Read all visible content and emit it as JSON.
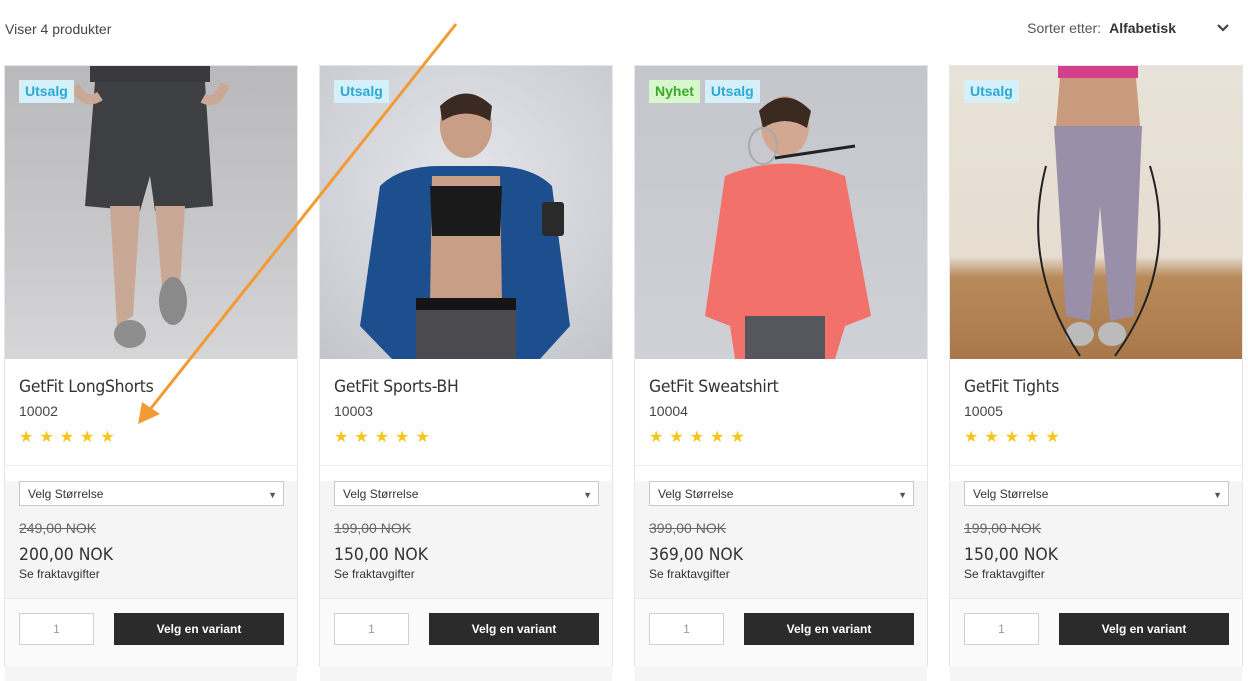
{
  "toolbar": {
    "count_text": "Viser 4 produkter",
    "sort_label": "Sorter etter:",
    "sort_value": "Alfabetisk"
  },
  "products": [
    {
      "badges": [
        "Utsalg"
      ],
      "name": "GetFit LongShorts",
      "sku": "10002",
      "rating": 5,
      "select_label": "Velg Størrelse",
      "old_price": "249,00 NOK",
      "price": "200,00 NOK",
      "shipping": "Se fraktavgifter",
      "qty": "1",
      "button": "Velg en variant"
    },
    {
      "badges": [
        "Utsalg"
      ],
      "name": "GetFit Sports-BH",
      "sku": "10003",
      "rating": 5,
      "select_label": "Velg Størrelse",
      "old_price": "199,00 NOK",
      "price": "150,00 NOK",
      "shipping": "Se fraktavgifter",
      "qty": "1",
      "button": "Velg en variant"
    },
    {
      "badges": [
        "Nyhet",
        "Utsalg"
      ],
      "name": "GetFit Sweatshirt",
      "sku": "10004",
      "rating": 5,
      "select_label": "Velg Størrelse",
      "old_price": "399,00 NOK",
      "price": "369,00 NOK",
      "shipping": "Se fraktavgifter",
      "qty": "1",
      "button": "Velg en variant"
    },
    {
      "badges": [
        "Utsalg"
      ],
      "name": "GetFit Tights",
      "sku": "10005",
      "rating": 5,
      "select_label": "Velg Størrelse",
      "old_price": "199,00 NOK",
      "price": "150,00 NOK",
      "shipping": "Se fraktavgifter",
      "qty": "1",
      "button": "Velg en variant"
    }
  ],
  "colors": {
    "sale_badge_bg": "#d5f0f8",
    "sale_badge_text": "#29a9d6",
    "new_badge_bg": "#d9f7cd",
    "new_badge_text": "#3ba92a",
    "star": "#f5c518",
    "button_bg": "#2b2b2b",
    "annotation_arrow": "#f39a33"
  },
  "icons": {
    "sort_toggle": "chevron-down-icon",
    "rating": "star-icon",
    "select_caret": "caret-down-icon"
  }
}
